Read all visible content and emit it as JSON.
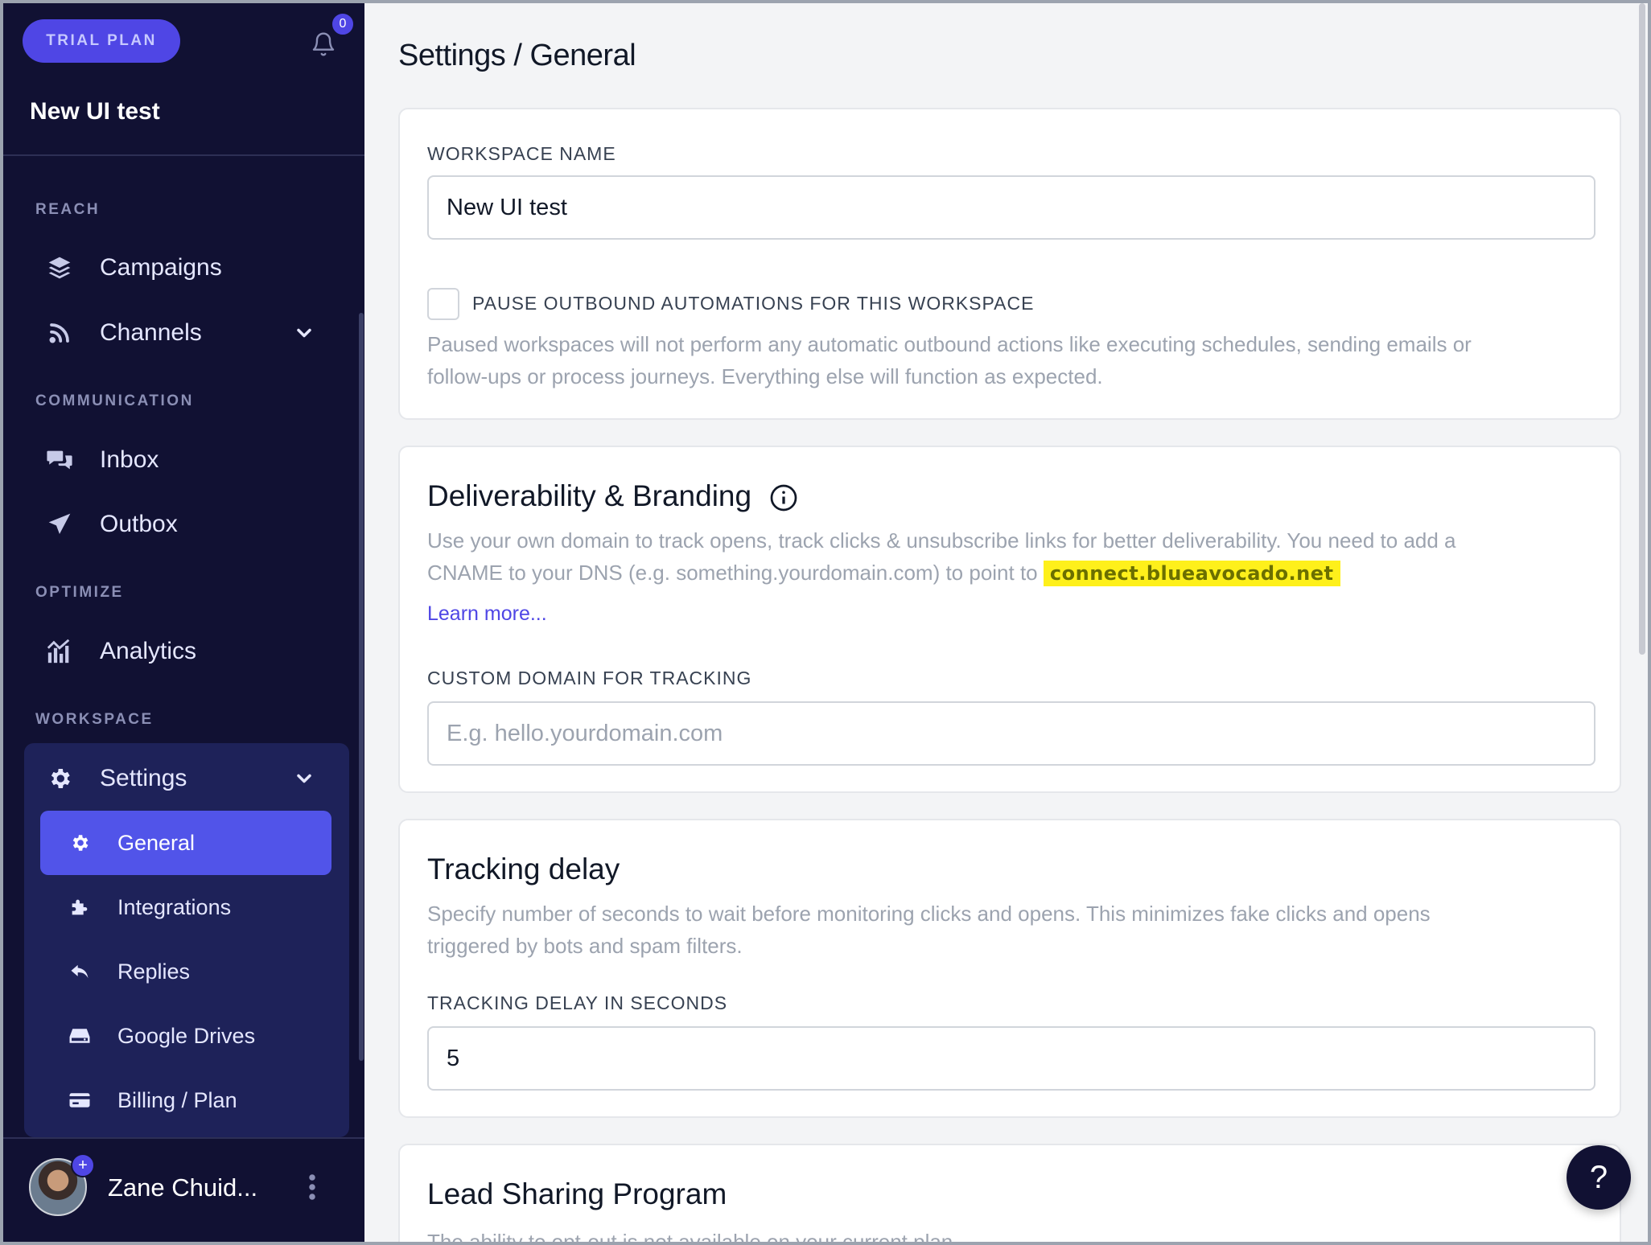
{
  "sidebar": {
    "trial_label": "TRIAL PLAN",
    "notification_count": "0",
    "workspace_name": "New UI test",
    "sections": {
      "reach": "REACH",
      "communication": "COMMUNICATION",
      "optimize": "OPTIMIZE",
      "workspace": "WORKSPACE"
    },
    "items": {
      "campaigns": "Campaigns",
      "channels": "Channels",
      "inbox": "Inbox",
      "outbox": "Outbox",
      "analytics": "Analytics",
      "settings": "Settings"
    },
    "settings_sub": {
      "general": "General",
      "integrations": "Integrations",
      "replies": "Replies",
      "google_drives": "Google Drives",
      "billing": "Billing / Plan"
    },
    "user": {
      "name": "Zane Chuid...",
      "avatar_badge": "+"
    }
  },
  "main": {
    "page_title": "Settings / General",
    "workspace_card": {
      "label": "WORKSPACE NAME",
      "value": "New UI test",
      "pause_label": "PAUSE OUTBOUND AUTOMATIONS FOR THIS WORKSPACE",
      "pause_help_1": "Paused workspaces will not perform any automatic outbound actions like executing schedules, sending emails or",
      "pause_help_2": "follow-ups or process journeys. Everything else will function as expected."
    },
    "deliverability_card": {
      "title": "Deliverability & Branding",
      "desc_1": "Use your own domain to track opens, track clicks & unsubscribe links for better deliverability. You need to add a",
      "desc_2": "CNAME to your DNS (e.g. something.yourdomain.com) to point to",
      "cname_target": "connect.blueavocado.net",
      "learn_more": "Learn more...",
      "domain_label": "CUSTOM DOMAIN FOR TRACKING",
      "domain_placeholder": "E.g. hello.yourdomain.com"
    },
    "tracking_card": {
      "title": "Tracking delay",
      "desc_1": "Specify number of seconds to wait before monitoring clicks and opens. This minimizes fake clicks and opens",
      "desc_2": "triggered by bots and spam filters.",
      "delay_label": "TRACKING DELAY IN SECONDS",
      "delay_value": "5"
    },
    "lead_card": {
      "title": "Lead Sharing Program",
      "desc": "The ability to opt-out is not available on your current plan"
    },
    "help_fab": "?"
  },
  "colors": {
    "sidebar_bg": "#111133",
    "accent": "#4f46e5",
    "active_item": "#5154e9",
    "highlight": "#fef01b"
  }
}
